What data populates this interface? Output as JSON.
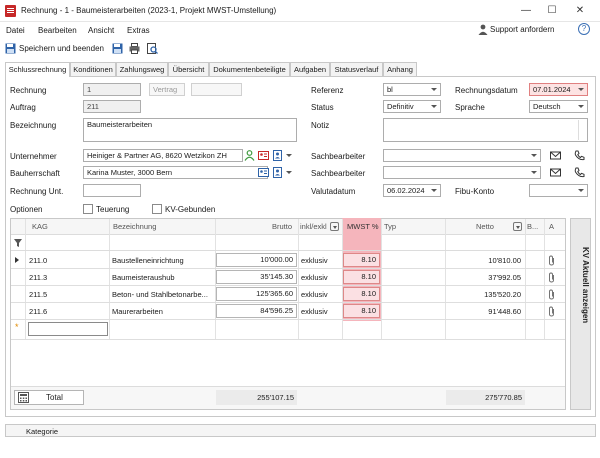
{
  "window": {
    "title": "Rechnung - 1 - Baumeisterarbeiten (2023-1, Projekt MWST-Umstellung)",
    "minimize": "—",
    "maximize": "☐",
    "close": "✕"
  },
  "menu": {
    "items": [
      "Datei",
      "Bearbeiten",
      "Ansicht",
      "Extras"
    ],
    "support": "Support anfordern",
    "help": "?"
  },
  "toolbar": {
    "save_close": "Speichern und beenden"
  },
  "tabs": [
    "Schlussrechnung",
    "Konditionen",
    "Zahlungsweg",
    "Übersicht",
    "Dokumentenbeteiligte",
    "Aufgaben",
    "Statusverlauf",
    "Anhang"
  ],
  "form": {
    "rechnung_label": "Rechnung",
    "rechnung_value": "1",
    "vertrag_label": "Vertrag",
    "vertrag_value": "",
    "auftrag_label": "Auftrag",
    "auftrag_value": "211",
    "bezeichnung_label": "Bezeichnung",
    "bezeichnung_value": "Baumeisterarbeiten",
    "unternehmer_label": "Unternehmer",
    "unternehmer_value": "Heiniger & Partner AG, 8620 Wetzikon ZH",
    "bauherrschaft_label": "Bauherrschaft",
    "bauherrschaft_value": "Karina Muster, 3000 Bern",
    "rechnung_unt_label": "Rechnung Unt.",
    "rechnung_unt_value": "",
    "optionen_label": "Optionen",
    "teuerung_label": "Teuerung",
    "kv_gebunden_label": "KV-Gebunden",
    "referenz_label": "Referenz",
    "referenz_value": "bl",
    "status_label": "Status",
    "status_value": "Definitiv",
    "notiz_label": "Notiz",
    "notiz_value": "",
    "sachbearbeiter_label": "Sachbearbeiter",
    "sachbearbeiter1_value": "",
    "sachbearbeiter2_value": "",
    "valutadatum_label": "Valutadatum",
    "valutadatum_value": "06.02.2024",
    "rechnungsdatum_label": "Rechnungsdatum",
    "rechnungsdatum_value": "07.01.2024",
    "sprache_label": "Sprache",
    "sprache_value": "Deutsch",
    "fibu_label": "Fibu-Konto",
    "fibu_value": ""
  },
  "grid": {
    "headers": {
      "kag": "KAG",
      "bezeichnung": "Bezeichnung",
      "brutto": "Brutto",
      "inkl_exkl": "inkl/exkl",
      "mwst": "MWST %",
      "typ": "Typ",
      "netto": "Netto",
      "b": "B...",
      "a": "A"
    },
    "rows": [
      {
        "kag": "211.0",
        "bezeichnung": "Baustelleneinrichtung",
        "brutto": "10'000.00",
        "inkl": "exklusiv",
        "mwst": "8.10",
        "netto": "10'810.00"
      },
      {
        "kag": "211.3",
        "bezeichnung": "Baumeisteraushub",
        "brutto": "35'145.30",
        "inkl": "exklusiv",
        "mwst": "8.10",
        "netto": "37'992.05"
      },
      {
        "kag": "211.5",
        "bezeichnung": "Beton- und Stahlbetonarbe...",
        "brutto": "125'365.60",
        "inkl": "exklusiv",
        "mwst": "8.10",
        "netto": "135'520.20"
      },
      {
        "kag": "211.6",
        "bezeichnung": "Maurerarbeiten",
        "brutto": "84'596.25",
        "inkl": "exklusiv",
        "mwst": "8.10",
        "netto": "91'448.60"
      }
    ],
    "total_label": "Total",
    "total_brutto": "255'107.15",
    "total_netto": "275'770.85",
    "side_panel": "KV Aktuell anzeigen"
  },
  "footer": {
    "kategorie": "Kategorie"
  },
  "colors": {
    "accent_red": "#f5b5bc",
    "date_red": "#fde3e3",
    "icon_blue": "#2f63a8",
    "icon_green": "#3f9a3f"
  }
}
